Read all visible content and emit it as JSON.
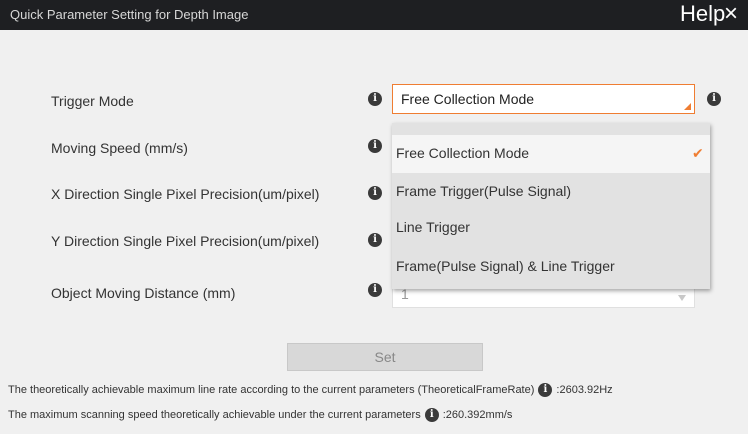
{
  "window": {
    "title": "Quick Parameter Setting for Depth Image",
    "help_label": "Help",
    "close_label": "×"
  },
  "form": {
    "trigger_mode": {
      "label": "Trigger Mode",
      "value": "Free Collection Mode"
    },
    "moving_speed": {
      "label": "Moving Speed (mm/s)"
    },
    "x_precision": {
      "label": "X Direction Single Pixel Precision(um/pixel)"
    },
    "y_precision": {
      "label": "Y Direction Single Pixel Precision(um/pixel)"
    },
    "object_distance": {
      "label": "Object Moving Distance (mm)",
      "value": "1"
    }
  },
  "dropdown": {
    "options": [
      "Free Collection Mode",
      "Frame Trigger(Pulse Signal)",
      "Line Trigger",
      "Frame(Pulse Signal) & Line Trigger"
    ],
    "selected_index": 0,
    "check": "✔"
  },
  "set_label": "Set",
  "results": {
    "line_rate_text": "The theoretically achievable maximum line rate according to the current parameters (TheoreticalFrameRate)",
    "line_rate_value": ":2603.92Hz",
    "scan_speed_text": "The maximum scanning speed theoretically achievable under the current parameters",
    "scan_speed_value": ":260.392mm/s"
  },
  "colors": {
    "accent": "#ef7d32",
    "titlebar": "#1e1f22"
  },
  "icons": {
    "info": "info-icon",
    "check": "check-icon",
    "grip": "resize-grip-icon"
  }
}
